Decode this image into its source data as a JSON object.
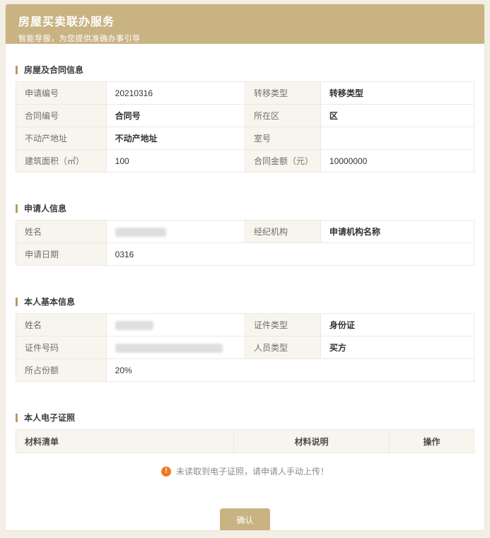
{
  "header": {
    "title": "房屋买卖联办服务",
    "subtitle": "智能导服，为您提供准确办事引导"
  },
  "colors": {
    "accent": "#c9b383",
    "section_bar": "#b59a67",
    "label_cell_bg": "#f8f5ee",
    "warning_icon": "#f0781e",
    "page_bg": "#f3efe5"
  },
  "icons": {
    "warning_glyph": "!"
  },
  "section_house": {
    "title": "房屋及合同信息",
    "rows": [
      {
        "l1": "申请编号",
        "v1": "20210316",
        "l2": "转移类型",
        "v2": "转移类型"
      },
      {
        "l1": "合同编号",
        "v1": "合同号",
        "l2": "所在区",
        "v2": "区"
      },
      {
        "l1": "不动产地址",
        "v1": "不动产地址",
        "l2": "室号",
        "v2": ""
      },
      {
        "l1": "建筑面积（㎡）",
        "v1": "100",
        "l2": "合同金额（元）",
        "v2": "10000000"
      }
    ]
  },
  "section_applicant": {
    "title": "申请人信息",
    "rows": [
      {
        "l1": "姓名",
        "v1_redacted": true,
        "l2": "经纪机构",
        "v2": "申请机构名称"
      },
      {
        "l1": "申请日期",
        "v1": "0316"
      }
    ]
  },
  "section_person": {
    "title": "本人基本信息",
    "rows": [
      {
        "l1": "姓名",
        "v1_redacted": true,
        "l2": "证件类型",
        "v2": "身份证"
      },
      {
        "l1": "证件号码",
        "v1_redacted": true,
        "l2": "人员类型",
        "v2": "买方"
      },
      {
        "l1": "所占份额",
        "v1": "20%"
      }
    ]
  },
  "section_license": {
    "title": "本人电子证照",
    "table_headers": [
      "材料清单",
      "材料说明",
      "操作"
    ],
    "warning_text": "未读取到电子证照，请申请人手动上传！"
  },
  "footer": {
    "confirm_label": "确认"
  }
}
